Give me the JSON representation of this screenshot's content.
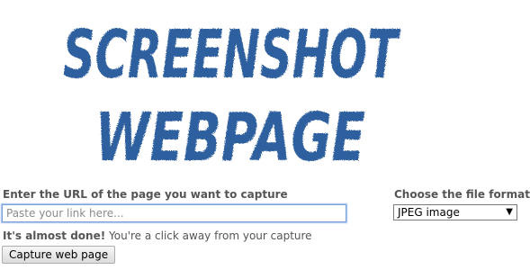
{
  "logo": {
    "line1": "SCREENSHOT",
    "line2": "WEBPAGE",
    "color": "#2f5f9e"
  },
  "url": {
    "label": "Enter the URL of the page you want to capture",
    "placeholder": "Paste your link here...",
    "value": ""
  },
  "format": {
    "label": "Choose the file format",
    "selected": "JPEG image",
    "arrow_icon": "triangle-down-icon"
  },
  "status": {
    "strong": "It's almost done!",
    "rest": " You're a click away from your capture"
  },
  "button": {
    "label": "Capture web page"
  }
}
